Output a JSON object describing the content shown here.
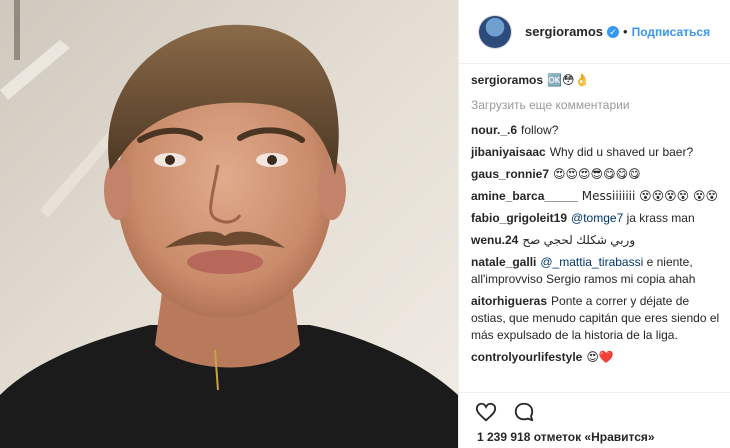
{
  "header": {
    "username": "sergioramos",
    "verified_glyph": "✓",
    "separator": "•",
    "follow_label": "Подписаться",
    "avatar_icon": "avatar-icon"
  },
  "caption": {
    "username": "sergioramos",
    "text": "🆗😳👌"
  },
  "load_more_label": "Загрузить еще комментарии",
  "comments": [
    {
      "user": "nour._.6",
      "text": "follow?"
    },
    {
      "user": "jibaniyaisaac",
      "text": "Why did u shaved ur baer?"
    },
    {
      "user": "gaus_ronnie7",
      "text": "😍😍😍😎😋😋😋"
    },
    {
      "user": "amine_barca_____",
      "text": "Messiiiiiii 😵😵😵😵 😵😵"
    },
    {
      "user": "fabio_grigoleit19",
      "mention": "@tomge7",
      "text": "ja krass man"
    },
    {
      "user": "wenu.24",
      "text": "وربي شكلك لحجي صح"
    },
    {
      "user": "natale_galli",
      "mention": "@_mattia_tirabassi",
      "text": "e niente, all'improvviso Sergio ramos mi copia ahah"
    },
    {
      "user": "aitorhigueras",
      "text": "Ponte a correr y déjate de ostias, que menudo capitán que eres siendo el más expulsado de la historia de la liga."
    },
    {
      "user": "controlyourlifestyle",
      "text": "😍❤️"
    }
  ],
  "likes": "1 239 918 отметок «Нравится»",
  "colors": {
    "accent": "#3897f0",
    "border": "#efefef",
    "muted": "#999999"
  },
  "icons": [
    "heart-icon",
    "comment-icon",
    "verified-badge-icon"
  ]
}
